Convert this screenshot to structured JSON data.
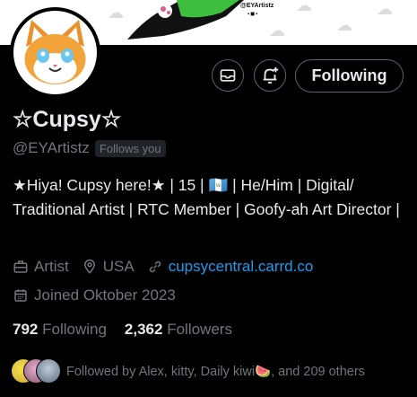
{
  "banner": {
    "handle": "@EYArtistz"
  },
  "actions": {
    "follow_label": "Following"
  },
  "profile": {
    "display_name": "☆Cupsy☆",
    "handle": "@EYArtistz",
    "follows_you": "Follows you",
    "bio": "★Hiya! Cupsy here!★ | 15 | 🇬🇹 | He/Him | Digital/ Traditional Artist | RTC Member | Goofy-ah Art Director |",
    "category": "Artist",
    "location": "USA",
    "website": "cupsycentral.carrd.co",
    "joined": "Joined Oktober 2023"
  },
  "stats": {
    "following_count": "792",
    "following_label": "Following",
    "followers_count": "2,362",
    "followers_label": "Followers"
  },
  "followed_by": {
    "text": "Followed by Alex, kitty, Daily kiwi🍉, and 209 others"
  },
  "colors": {
    "accent": "#1d9bf0",
    "muted": "#71767b",
    "text": "#e7e9ea",
    "background": "#000000"
  }
}
